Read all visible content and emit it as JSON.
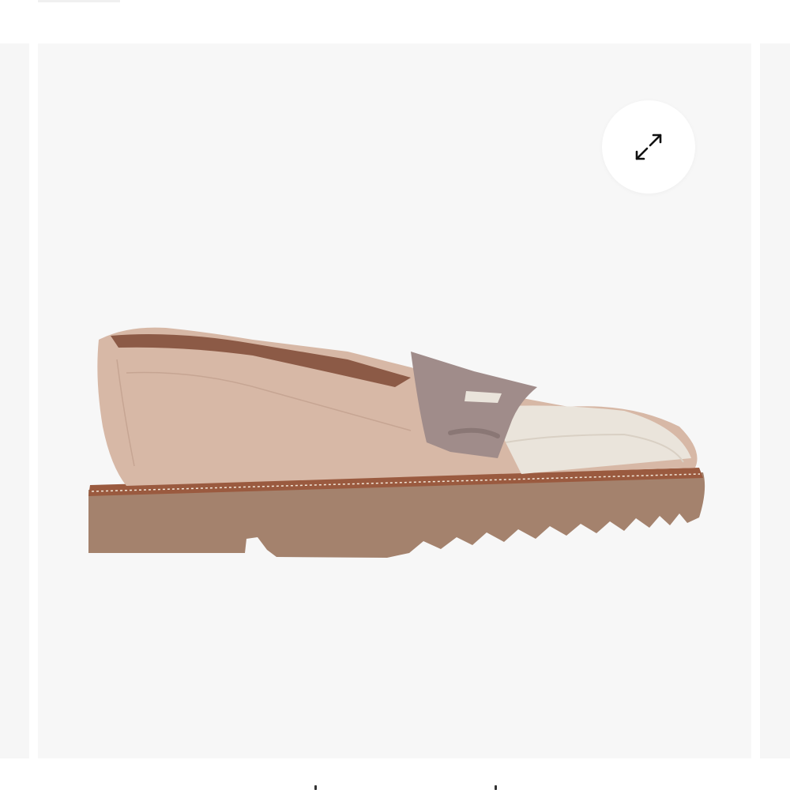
{
  "gallery": {
    "expand_button": {
      "icon": "expand-arrows-icon"
    },
    "product_image": {
      "icon": "loafer-shoe-image"
    },
    "colors": {
      "main_bg": "#f7f7f7",
      "side_bg": "#f6f6f6",
      "suede": "#d7b8a6",
      "saddle": "#a08c8a",
      "toe_cap": "#eae4db",
      "sole": "#a4826d",
      "welt": "#9a5a3f"
    }
  }
}
